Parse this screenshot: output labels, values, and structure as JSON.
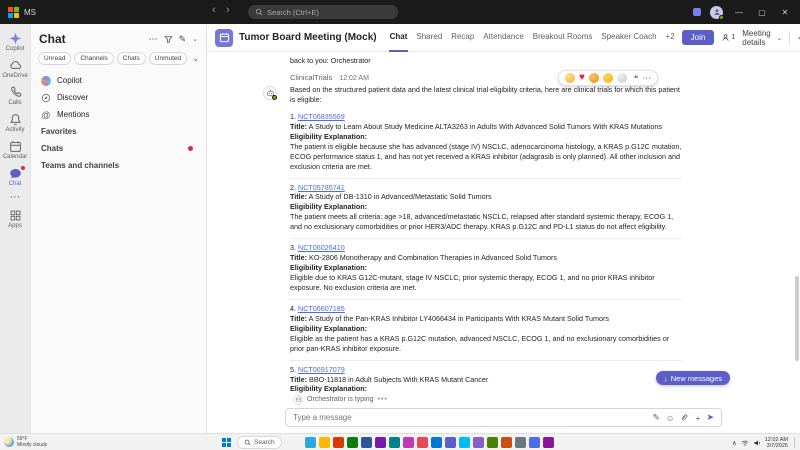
{
  "colors": {
    "accent": "#5b5fc7",
    "titlebar_bg": "#1b1b1b",
    "link": "#4f6bed",
    "presence_green": "#6bb700",
    "badge_red": "#c4314b"
  },
  "icons": {
    "back": "‹",
    "forward": "›",
    "more": "⋯",
    "chevron_down": "⌄",
    "chevron_up": "∧",
    "minimize": "—",
    "maximize": "▢",
    "close": "✕",
    "mention": "@",
    "quote": "❝",
    "arrow_down": "↓",
    "send": "➤",
    "format": "✎",
    "emoji": "☺",
    "plus": "+",
    "compose": "✎",
    "heart": "♥",
    "dots": "•••"
  },
  "titlebar": {
    "app_label": "MS",
    "search_placeholder": "Search (Ctrl+E)"
  },
  "rail": {
    "items": [
      {
        "label": "Copilot"
      },
      {
        "label": "OneDrive"
      },
      {
        "label": "Calls"
      },
      {
        "label": "Activity"
      },
      {
        "label": "Calendar"
      },
      {
        "label": "Chat"
      },
      {
        "label": "Apps"
      }
    ]
  },
  "chat_panel": {
    "title": "Chat",
    "filters": [
      "Unread",
      "Channels",
      "Chats",
      "Unmuted"
    ],
    "quick_items": [
      "Copilot",
      "Discover",
      "Mentions"
    ],
    "sections": [
      "Favorites",
      "Chats",
      "Teams and channels"
    ]
  },
  "meeting_header": {
    "title": "Tumor Board Meeting (Mock)",
    "tabs": [
      "Chat",
      "Shared",
      "Recap",
      "Attendance",
      "Breakout Rooms",
      "Speaker Coach",
      "+2"
    ],
    "join": "Join",
    "attendee_count": "1",
    "details": "Meeting details"
  },
  "conversation": {
    "scroll_previous": "back to you: Orchestrator",
    "sender": "ClinicalTrials",
    "timestamp": "12:02 AM",
    "intro": "Based on the structured patient data and the latest clinical trial eligibility criteria, here are clinical trials for which this patient is eligible:",
    "labels": {
      "title": "Title:",
      "eligibility": "Eligibility Explanation:"
    },
    "trials": [
      {
        "num": "1.",
        "nct": "NCT06835569",
        "title": "A Study to Learn About Study Medicine ALTA3263 in Adults With Advanced Solid Tumors With KRAS Mutations",
        "explanation": "The patient is eligible because she has advanced (stage IV) NSCLC, adenocarcinoma histology, a KRAS p.G12C mutation, ECOG performance status 1, and has not yet received a KRAS inhibitor (adagrasib is only planned). All other inclusion and exclusion criteria are met."
      },
      {
        "num": "2.",
        "nct": "NCT05785741",
        "title": "A Study of DB-1310 in Advanced/Metastatic Solid Tumors",
        "explanation": "The patient meets all criteria: age >18, advanced/metastatic NSCLC, relapsed after standard systemic therapy, ECOG 1, and no exclusionary comorbidities or prior HER3/ADC therapy. KRAS p.G12C and PD-L1 status do not affect eligibility."
      },
      {
        "num": "3.",
        "nct": "NCT06026410",
        "title": "KO-2806 Monotherapy and Combination Therapies in Advanced Solid Tumors",
        "explanation": "Eligible due to KRAS G12C-mutant, stage IV NSCLC, prior systemic therapy, ECOG 1, and no prior KRAS inhibitor exposure. No exclusion criteria are met."
      },
      {
        "num": "4.",
        "nct": "NCT06607185",
        "title": "A Study of the Pan-KRAS Inhibitor LY4066434 in Participants With KRAS Mutant Solid Tumors",
        "explanation": "Eligible as the patient has a KRAS p.G12C mutation, advanced NSCLC, ECOG 1, and no exclusionary comorbidities or prior pan-KRAS inhibitor exposure."
      },
      {
        "num": "5.",
        "nct": "NCT06917079",
        "title": "BBO-11818 in Adult Subjects With KRAS Mutant Cancer",
        "explanation": ""
      }
    ],
    "reactions": [
      "like",
      "heart",
      "laugh",
      "surprised",
      "sad"
    ],
    "new_messages": "New messages",
    "typing": "Orchestrator is typing"
  },
  "composer": {
    "placeholder": "Type a message"
  },
  "taskbar": {
    "weather_temp": "59°F",
    "weather_desc": "Mostly cloudy",
    "search": "Search",
    "time": "12:02 AM",
    "date": "3/7/2025",
    "app_colors": [
      "#2aa7de",
      "#ffb900",
      "#d83b01",
      "#107c10",
      "#2b579a",
      "#7719aa",
      "#038387",
      "#c239b3",
      "#e74856",
      "#0078d4",
      "#5b5fc7",
      "#00bcf2",
      "#8661c5",
      "#498205",
      "#ca5010",
      "#69797e",
      "#4f6bed",
      "#881798"
    ]
  }
}
